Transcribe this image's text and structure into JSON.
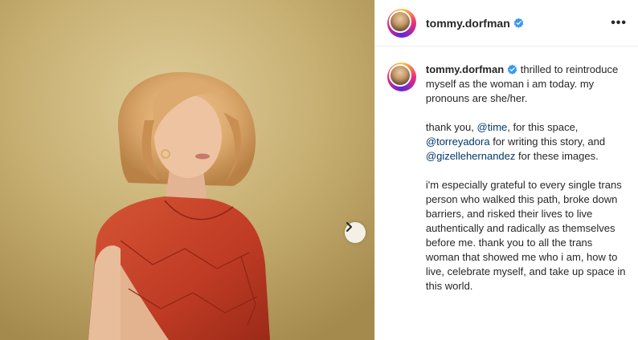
{
  "post": {
    "username": "tommy.dorfman",
    "more_label": "•••"
  },
  "caption": {
    "username": "tommy.dorfman",
    "p1": "thrilled to reintroduce myself as the woman i am today. my pronouns are she/her.",
    "p2_a": "thank you, ",
    "mention1": "@time",
    "p2_b": ", for this space, ",
    "mention2": "@torreyadora",
    "p2_c": " for writing this story, and ",
    "mention3": "@gizellehernandez",
    "p2_d": " for these images.",
    "p3": "i'm especially grateful to every single trans person who walked this path, broke down barriers, and risked their lives to live authentically and radically as themselves before me. thank you to all the trans woman that showed me who i am, how to live, celebrate myself, and take up space in this world."
  },
  "colors": {
    "verified": "#3897f0",
    "mention": "#00376b",
    "dress": "#c2402a",
    "background": "#c9b276"
  },
  "icons": {
    "verified": "verified-badge-icon",
    "next": "chevron-right-icon",
    "more": "more-options-icon"
  }
}
